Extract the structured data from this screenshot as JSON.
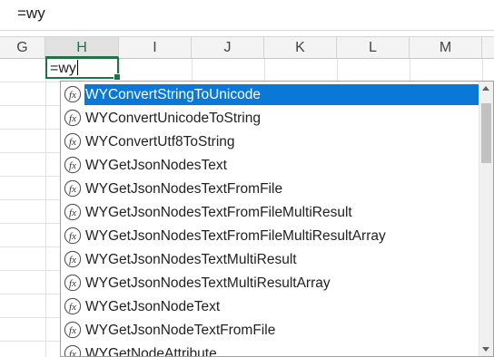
{
  "formula_bar": {
    "value": "=wy"
  },
  "columns": [
    {
      "label": "G",
      "selected": false
    },
    {
      "label": "H",
      "selected": true
    },
    {
      "label": "I",
      "selected": false
    },
    {
      "label": "J",
      "selected": false
    },
    {
      "label": "K",
      "selected": false
    },
    {
      "label": "L",
      "selected": false
    },
    {
      "label": "M",
      "selected": false
    }
  ],
  "active_cell": {
    "value": "=wy"
  },
  "autocomplete": {
    "icon": "function-fx-icon",
    "items": [
      "WYConvertStringToUnicode",
      "WYConvertUnicodeToString",
      "WYConvertUtf8ToString",
      "WYGetJsonNodesText",
      "WYGetJsonNodesTextFromFile",
      "WYGetJsonNodesTextFromFileMultiResult",
      "WYGetJsonNodesTextFromFileMultiResultArray",
      "WYGetJsonNodesTextMultiResult",
      "WYGetJsonNodesTextMultiResultArray",
      "WYGetJsonNodeText",
      "WYGetJsonNodeTextFromFile",
      "WYGetNodeAttribute"
    ],
    "selected_index": 0
  },
  "colors": {
    "accent": "#217346",
    "selection": "#0a78d7"
  }
}
